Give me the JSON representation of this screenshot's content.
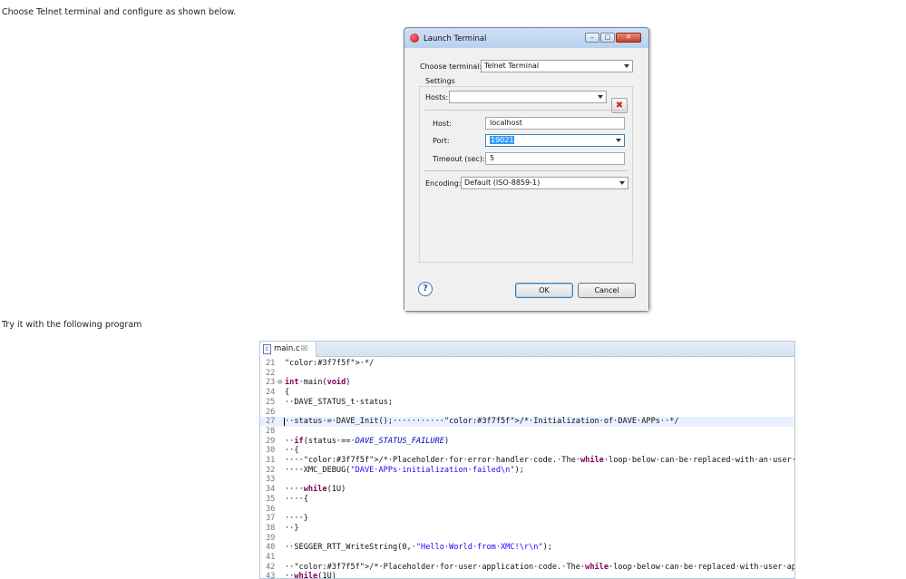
{
  "instructions": {
    "line1": "Choose Telnet terminal and configure as shown below.",
    "line2": "Try it with the following program"
  },
  "dialog": {
    "title": "Launch Terminal",
    "window_buttons": {
      "minimize": "–",
      "maximize": "□",
      "close": "✕"
    },
    "choose_terminal_label": "Choose terminal:",
    "choose_terminal_value": "Telnet Terminal",
    "settings_label": "Settings",
    "hosts_label": "Hosts:",
    "hosts_value": "",
    "host_label": "Host:",
    "host_value": "localhost",
    "port_label": "Port:",
    "port_value": "19021",
    "timeout_label": "Timeout (sec):",
    "timeout_value": "5",
    "encoding_label": "Encoding:",
    "encoding_value": "Default (ISO-8859-1)",
    "delete_glyph": "✖",
    "help_glyph": "?",
    "ok_label": "OK",
    "cancel_label": "Cancel"
  },
  "editor": {
    "tab_label": "main.c",
    "tab_close": "☒",
    "file_icon_glyph": "c",
    "lines": [
      {
        "n": "21",
        "t": "·*/"
      },
      {
        "n": "22",
        "t": ""
      },
      {
        "n": "23",
        "t": "int·main(void)"
      },
      {
        "n": "24",
        "t": "{"
      },
      {
        "n": "25",
        "t": "··DAVE_STATUS_t·status;"
      },
      {
        "n": "26",
        "t": ""
      },
      {
        "n": "27",
        "t": "··status·=·DAVE_Init();···········/*·Initialization·of·DAVE·APPs··*/"
      },
      {
        "n": "28",
        "t": ""
      },
      {
        "n": "29",
        "t": "··if(status·==·DAVE_STATUS_FAILURE)"
      },
      {
        "n": "30",
        "t": "··{"
      },
      {
        "n": "31",
        "t": "····/*·Placeholder·for·error·handler·code.·The·while·loop·below·can·be·replaced·with·an·user·error·handler.·*/"
      },
      {
        "n": "32",
        "t": "····XMC_DEBUG(\"DAVE·APPs·initialization·failed\\n\");"
      },
      {
        "n": "33",
        "t": ""
      },
      {
        "n": "34",
        "t": "····while(1U)"
      },
      {
        "n": "35",
        "t": "····{"
      },
      {
        "n": "36",
        "t": ""
      },
      {
        "n": "37",
        "t": "····}"
      },
      {
        "n": "38",
        "t": "··}"
      },
      {
        "n": "39",
        "t": ""
      },
      {
        "n": "40",
        "t": "··SEGGER_RTT_WriteString(0,·\"Hello·World·from·XMC!\\r\\n\");"
      },
      {
        "n": "41",
        "t": ""
      },
      {
        "n": "42",
        "t": "··/*·Placeholder·for·user·application·code.·The·while·loop·below·can·be·replaced·with·user·application·code.·*/"
      },
      {
        "n": "43",
        "t": "··while(1U)"
      }
    ]
  },
  "colors": {
    "keyword": "#7f0055",
    "comment": "#3f7f5f",
    "string": "#2a00ff",
    "macro": "#0000c0"
  }
}
